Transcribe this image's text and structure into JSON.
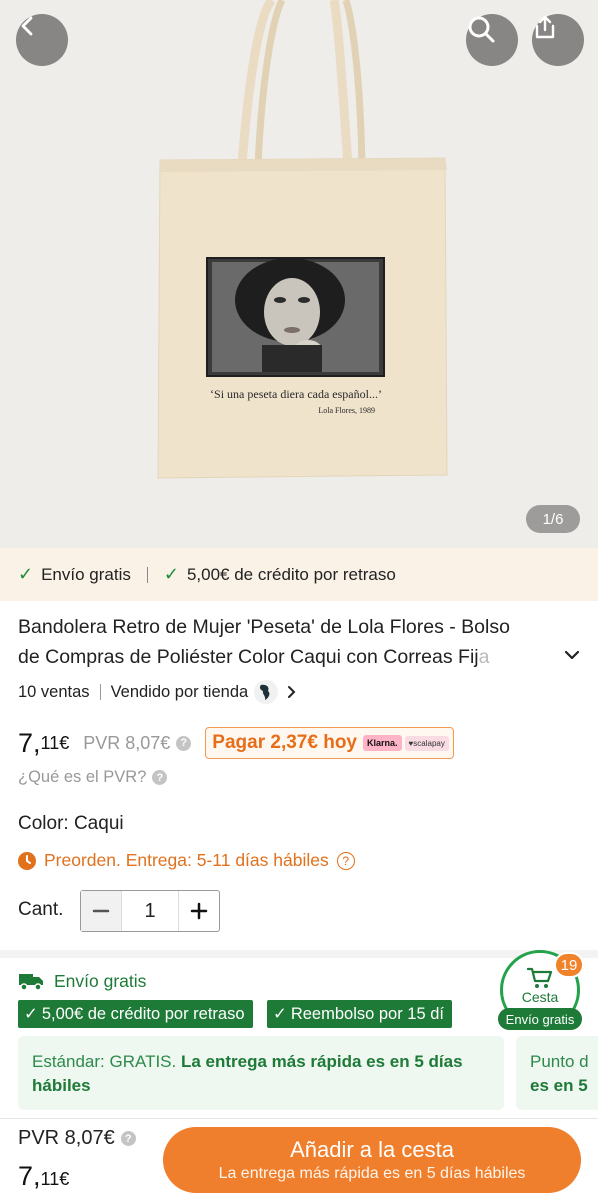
{
  "hero": {
    "image_counter": "1/6",
    "bag_quote": "‘Si una peseta diera cada español...’",
    "bag_signature": "Lola Flores, 1989",
    "icons": [
      "back-arrow-icon",
      "search-icon",
      "share-icon"
    ]
  },
  "shipping_strip": {
    "item1": "Envío gratis",
    "item2": "5,00€ de crédito por retraso"
  },
  "product": {
    "title_line1": "Bandolera Retro de Mujer 'Peseta' de Lola Flores - Bolso",
    "title_line2": "de Compras de Poliéster Color Caqui con Correas Fij",
    "title_fade": "a",
    "sales": "10 ventas",
    "seller": "Vendido por tienda",
    "price_int": "7,",
    "price_dec": "11€",
    "pvr": "PVR 8,07€",
    "pay_today": "Pagar 2,37€ hoy",
    "klarna": "Klarna.",
    "scalapay": "♥scalapay",
    "what_pvr": "¿Qué es el PVR?",
    "color": "Color: Caqui",
    "preorder": "Preorden. Entrega: 5-11 días hábiles",
    "qty_label": "Cant.",
    "qty_value": "1"
  },
  "shipping": {
    "free": "Envío gratis",
    "tags": [
      "5,00€ de crédito por retraso",
      "Reembolso por 15 dí"
    ],
    "card1_std": "Estándar: GRATIS.",
    "card1_fast": " La entrega más rápida es en 5 días hábiles",
    "card2_line1": "Punto d",
    "card2_line2": "es en 5"
  },
  "cart": {
    "badge": "19",
    "label": "Cesta",
    "pill": "Envío gratis"
  },
  "bottom": {
    "pvr": "PVR 8,07€",
    "price_int": "7,",
    "price_dec": "11€",
    "add_main": "Añadir a la cesta",
    "add_sub": "La entrega más rápida es en 5 días hábiles"
  },
  "colors": {
    "accent_orange": "#ef7f2c",
    "green": "#1e7a37",
    "strip_bg": "#fbf2e7"
  }
}
